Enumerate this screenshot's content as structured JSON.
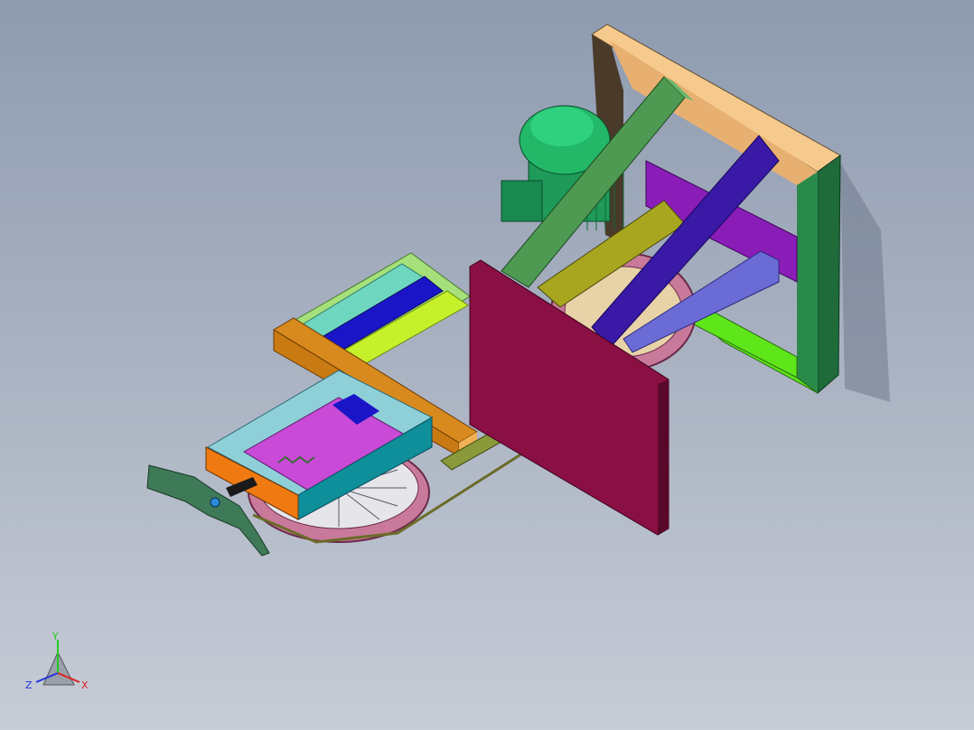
{
  "viewport": {
    "background_top": "#8e9bb0",
    "background_bottom": "#c7ccd6"
  },
  "triad": {
    "y_label": "Y",
    "x_label": "X",
    "z_label": "Z",
    "y_color": "#22cc22",
    "x_color": "#dd2222",
    "z_color": "#2233dd"
  },
  "model": {
    "colors": {
      "frame_top": "#f6c98c",
      "frame_side": "#1f6b3a",
      "frame_dark": "#4a3a2a",
      "plate": "#8a0f43",
      "motor": "#1f9a59",
      "green_beam": "#4e9a52",
      "olive_beam": "#a8a61f",
      "indigo_beam": "#3a19a6",
      "lavender_beam": "#6b6bd6",
      "purple_beam": "#8a1cb8",
      "lime_beam": "#5ee61a",
      "orange_beam": "#c97a12",
      "teal_beam": "#6fd6bf",
      "blue_beam": "#1a16c8",
      "yellow_beam": "#c6f02a",
      "light_green_frame": "#a5e07a",
      "fixture_front": "#f07a12",
      "fixture_top": "#8fd0d8",
      "fixture_side": "#0f8f9a",
      "handle": "#3f7a58",
      "wheel": "#c97a9a",
      "belt": "#6b6b2a"
    }
  }
}
